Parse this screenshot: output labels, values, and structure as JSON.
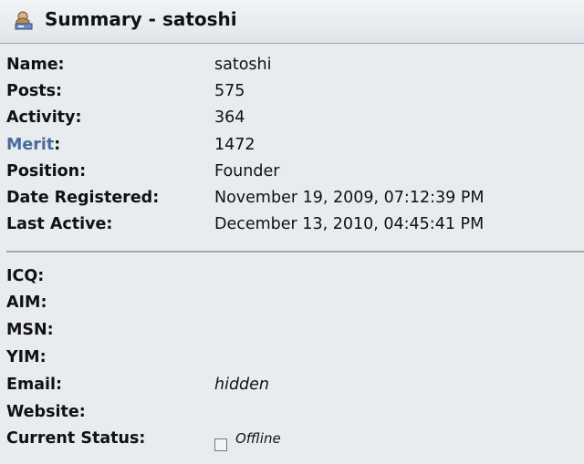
{
  "header": {
    "icon": "user-icon",
    "title": "Summary - satoshi"
  },
  "profile": {
    "name": {
      "label": "Name:",
      "value": "satoshi"
    },
    "posts": {
      "label": "Posts:",
      "value": "575"
    },
    "activity": {
      "label": "Activity:",
      "value": "364"
    },
    "merit": {
      "label_link": "Merit",
      "label_suffix": ":",
      "value": "1472"
    },
    "position": {
      "label": "Position:",
      "value": "Founder"
    },
    "registered": {
      "label": "Date Registered:",
      "value": "November 19, 2009, 07:12:39 PM"
    },
    "last_active": {
      "label": "Last Active:",
      "value": "December 13, 2010, 04:45:41 PM"
    }
  },
  "contact": {
    "icq": {
      "label": "ICQ:"
    },
    "aim": {
      "label": "AIM:"
    },
    "msn": {
      "label": "MSN:"
    },
    "yim": {
      "label": "YIM:"
    },
    "email": {
      "label": "Email:",
      "value": "hidden"
    },
    "website": {
      "label": "Website:"
    },
    "status": {
      "label": "Current Status:",
      "value": "Offline",
      "icon": "offline-status-icon"
    }
  },
  "colors": {
    "merit_link": "#4a6a9a",
    "header_bg": "#e6e9ed"
  }
}
